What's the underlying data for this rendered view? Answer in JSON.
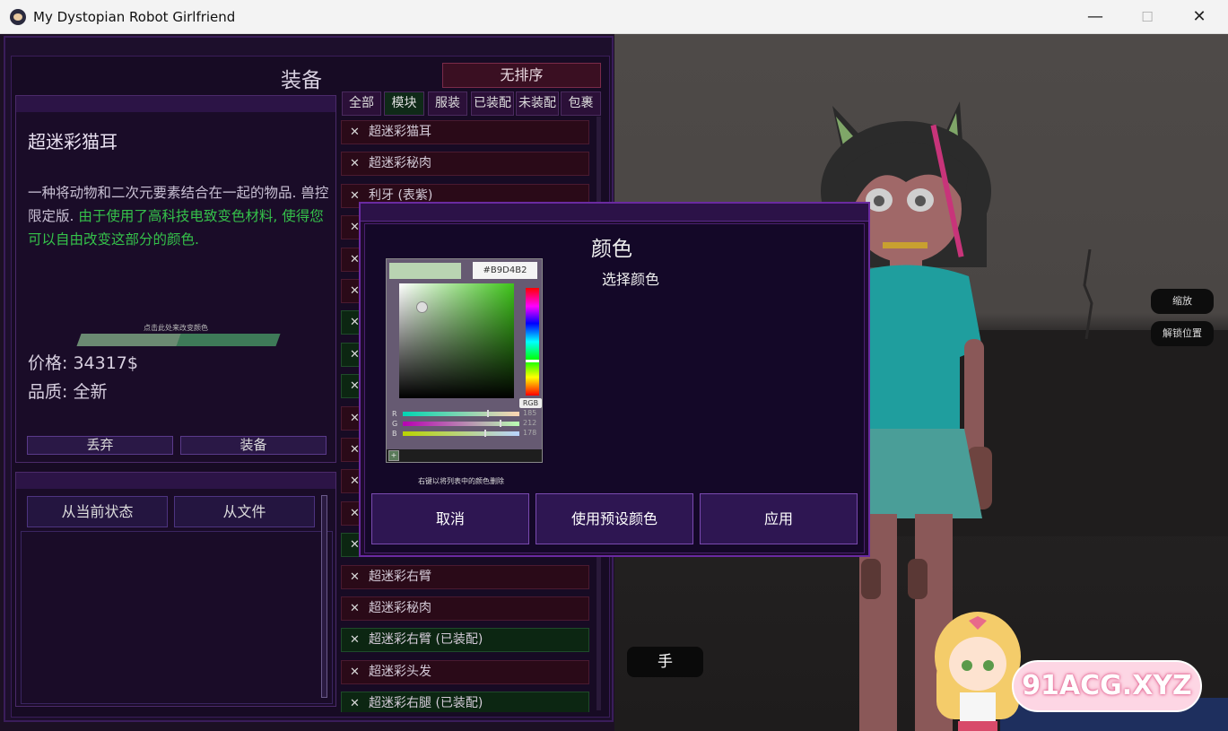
{
  "window": {
    "title": "My Dystopian Robot Girlfriend",
    "minimize": "—",
    "maximize": "☐",
    "close": "✕"
  },
  "inventory": {
    "title": "装备",
    "sort_label": "无排序",
    "tabs": [
      "全部",
      "模块",
      "服装",
      "已装配",
      "未装配",
      "包裹"
    ],
    "active_tab": "模块",
    "items": [
      {
        "label": "超迷彩猫耳",
        "equipped": false
      },
      {
        "label": "超迷彩秘肉",
        "equipped": false
      },
      {
        "label": "利牙 (表紫)",
        "equipped": false
      },
      {
        "label": "",
        "equipped": false
      },
      {
        "label": "",
        "equipped": false
      },
      {
        "label": "",
        "equipped": false
      },
      {
        "label": "",
        "equipped": true
      },
      {
        "label": "",
        "equipped": true
      },
      {
        "label": "",
        "equipped": true
      },
      {
        "label": "",
        "equipped": false
      },
      {
        "label": "",
        "equipped": false
      },
      {
        "label": "",
        "equipped": false
      },
      {
        "label": "",
        "equipped": false
      },
      {
        "label": "",
        "equipped": true
      },
      {
        "label": "超迷彩右臂",
        "equipped": false
      },
      {
        "label": "超迷彩秘肉",
        "equipped": false
      },
      {
        "label": "超迷彩右臂 (已装配)",
        "equipped": true
      },
      {
        "label": "超迷彩头发",
        "equipped": false
      },
      {
        "label": "超迷彩右腿 (已装配)",
        "equipped": true
      }
    ]
  },
  "detail": {
    "name": "超迷彩猫耳",
    "desc_plain": "一种将动物和二次元要素结合在一起的物品. 兽控限定版. ",
    "desc_highlight": "由于使用了高科技电致变色材料, 使得您可以自由改变这部分的颜色.",
    "color_hint": "点击此处来改变颜色",
    "color_fill_fraction": 0.5,
    "price": "价格: 34317$",
    "quality": "品质: 全新",
    "discard_label": "丢弃",
    "equip_label": "装备"
  },
  "presets": {
    "from_state_label": "从当前状态",
    "from_file_label": "从文件"
  },
  "scene": {
    "zoom_label": "缩放",
    "unlock_label": "解锁位置",
    "hand_label": "手"
  },
  "color_dialog": {
    "title": "颜色",
    "subtitle": "选择颜色",
    "hex": "#B9D4B2",
    "mode_label": "RGB",
    "channels": [
      {
        "name": "R",
        "value": "185"
      },
      {
        "name": "G",
        "value": "212"
      },
      {
        "name": "B",
        "value": "178"
      }
    ],
    "hint": "右键以将列表中的颜色删除",
    "cancel_label": "取消",
    "preset_label": "使用预设颜色",
    "apply_label": "应用",
    "swatch_color": "#b9d4b2"
  },
  "watermark": {
    "text": "91ACG.XYZ"
  }
}
